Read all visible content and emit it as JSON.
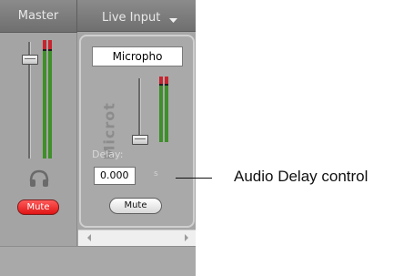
{
  "header": {
    "master_tab": "Master",
    "live_input_tab": "Live Input"
  },
  "master": {
    "mute_label": "Mute",
    "mute_color": "#e01414",
    "headphones_icon": "headphones-icon"
  },
  "channel": {
    "name_value": "Micropho",
    "vertical_label": "Microt",
    "delay_label": "Delay:",
    "delay_value": "0.000",
    "delay_unit": "s",
    "mute_label": "Mute"
  },
  "annotation": {
    "callout": "Audio Delay control"
  }
}
